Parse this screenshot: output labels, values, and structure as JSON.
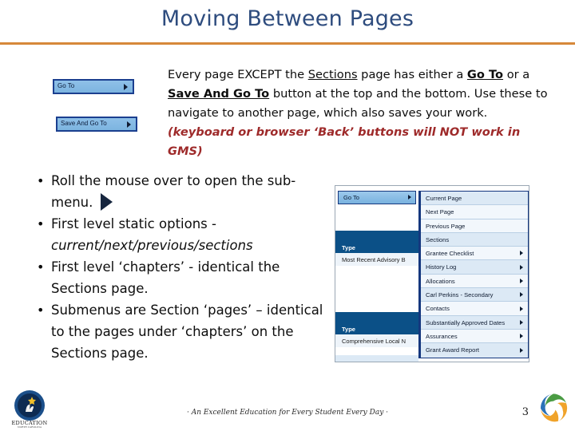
{
  "slide": {
    "title": "Moving Between Pages",
    "page_number": "3",
    "footer_tagline": "· An Excellent Education for Every Student Every Day ·",
    "accent_rule_color": "#D6883A",
    "title_color": "#2E4C7E",
    "warning_color": "#9E2A2A"
  },
  "buttons": {
    "go_to": "Go To",
    "save_and_go_to": "Save And Go To"
  },
  "paragraph": {
    "part1": "Every page EXCEPT the ",
    "link1": "Sections",
    "part2": " page has either a ",
    "link2": "Go To",
    "part3": " or a ",
    "link3": "Save And Go To",
    "part4": " button at the top and the bottom.  Use these to navigate to another page, which also saves your work.  ",
    "warning": "(keyboard or browser ‘Back’ buttons will NOT work in GMS)"
  },
  "bullets": [
    {
      "text": "Roll the mouse over to open the sub-menu.",
      "has_arrow": true,
      "italic_tail": ""
    },
    {
      "text": "First level static options - ",
      "has_arrow": false,
      "italic_tail": "current/next/previous/sections"
    },
    {
      "text": "First level ‘chapters’ -  identical the Sections page.",
      "has_arrow": false,
      "italic_tail": ""
    },
    {
      "text": "Submenus are Section ‘pages’ – identical to the pages under ‘chapters’ on the Sections page.",
      "has_arrow": false,
      "italic_tail": ""
    }
  ],
  "gms_screenshot": {
    "goto_tab_label": "Go To",
    "left_panel": [
      {
        "header": "Type",
        "value": "Most Recent Advisory B"
      },
      {
        "header": "Type",
        "value": "Comprehensive Local N"
      }
    ],
    "menu_items": [
      {
        "label": "Current Page",
        "submenu": false
      },
      {
        "label": "Next Page",
        "submenu": false
      },
      {
        "label": "Previous Page",
        "submenu": false
      },
      {
        "label": "Sections",
        "submenu": false
      },
      {
        "label": "Grantee Checklist",
        "submenu": true
      },
      {
        "label": "History Log",
        "submenu": true
      },
      {
        "label": "Allocations",
        "submenu": true
      },
      {
        "label": "Carl Perkins - Secondary",
        "submenu": true
      },
      {
        "label": "Contacts",
        "submenu": true
      },
      {
        "label": "Substantially Approved Dates",
        "submenu": true
      },
      {
        "label": "Assurances",
        "submenu": true
      },
      {
        "label": "Grant Award Report",
        "submenu": true
      }
    ]
  },
  "logos": {
    "education_logo_alt": "education-seal-logo",
    "swirl_logo_alt": "tricolor-swirl-logo"
  }
}
